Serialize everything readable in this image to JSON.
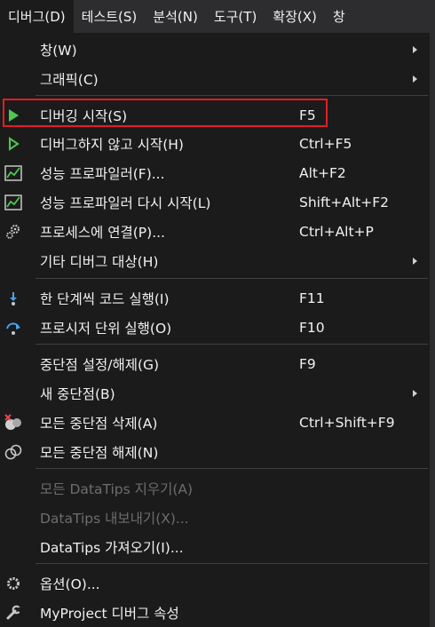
{
  "menubar": {
    "items": [
      "디버그(D)",
      "테스트(S)",
      "분석(N)",
      "도구(T)",
      "확장(X)",
      "창"
    ]
  },
  "menu": {
    "window": "창(W)",
    "graphics": "그래픽(C)",
    "start_debugging": {
      "label": "디버깅 시작(S)",
      "shortcut": "F5"
    },
    "start_without_debugging": {
      "label": "디버그하지 않고 시작(H)",
      "shortcut": "Ctrl+F5"
    },
    "perf_profiler": {
      "label": "성능 프로파일러(F)...",
      "shortcut": "Alt+F2"
    },
    "relaunch_profiler": {
      "label": "성능 프로파일러 다시 시작(L)",
      "shortcut": "Shift+Alt+F2"
    },
    "attach_to_process": {
      "label": "프로세스에 연결(P)...",
      "shortcut": "Ctrl+Alt+P"
    },
    "other_debug_targets": "기타 디버그 대상(H)",
    "step_into": {
      "label": "한 단계씩 코드 실행(I)",
      "shortcut": "F11"
    },
    "step_over": {
      "label": "프로시저 단위 실행(O)",
      "shortcut": "F10"
    },
    "toggle_breakpoint": {
      "label": "중단점 설정/해제(G)",
      "shortcut": "F9"
    },
    "new_breakpoint": "새 중단점(B)",
    "delete_all_breakpoints": {
      "label": "모든 중단점 삭제(A)",
      "shortcut": "Ctrl+Shift+F9"
    },
    "disable_all_breakpoints": "모든 중단점 해제(N)",
    "clear_datatips": "모든 DataTips 지우기(A)",
    "export_datatips": "DataTips 내보내기(X)...",
    "import_datatips": "DataTips 가져오기(I)...",
    "options": "옵션(O)...",
    "project_properties": "MyProject 디버그 속성"
  },
  "colors": {
    "background": "#1b1b1c",
    "menubar": "#2d2d30",
    "play_green": "#4ec94e",
    "highlight_red": "#e51c23",
    "step_blue": "#4aa3f0"
  }
}
